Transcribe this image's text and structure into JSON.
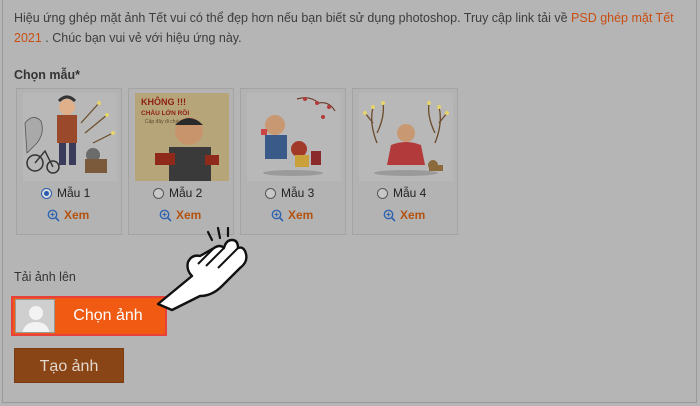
{
  "intro": {
    "text_before": "Hiệu ứng ghép mặt ảnh Tết vui có thể đẹp hơn nếu bạn biết sử dụng photoshop. Truy cập link tải về ",
    "link": "PSD ghép mặt Tết 2021",
    "text_after": " . Chúc bạn vui vẻ với hiệu ứng này."
  },
  "templates": {
    "label": "Chọn mẫu*",
    "items": [
      {
        "label": "Mẫu 1",
        "view": "Xem",
        "selected": true
      },
      {
        "label": "Mẫu 2",
        "view": "Xem",
        "selected": false,
        "poster_line1": "KHÔNG !!!",
        "poster_line2": "CHÁU LỚN RỒI",
        "poster_line3": "Cấp đây đi chứ"
      },
      {
        "label": "Mẫu 3",
        "view": "Xem",
        "selected": false
      },
      {
        "label": "Mẫu 4",
        "view": "Xem",
        "selected": false
      }
    ]
  },
  "upload": {
    "label": "Tải ảnh lên",
    "button": "Chọn ảnh"
  },
  "create_button": "Tạo ảnh",
  "colors": {
    "accent": "#f05a12",
    "link": "#c94e12",
    "highlight_border": "#e8403a",
    "create_button": "#8a4516"
  }
}
